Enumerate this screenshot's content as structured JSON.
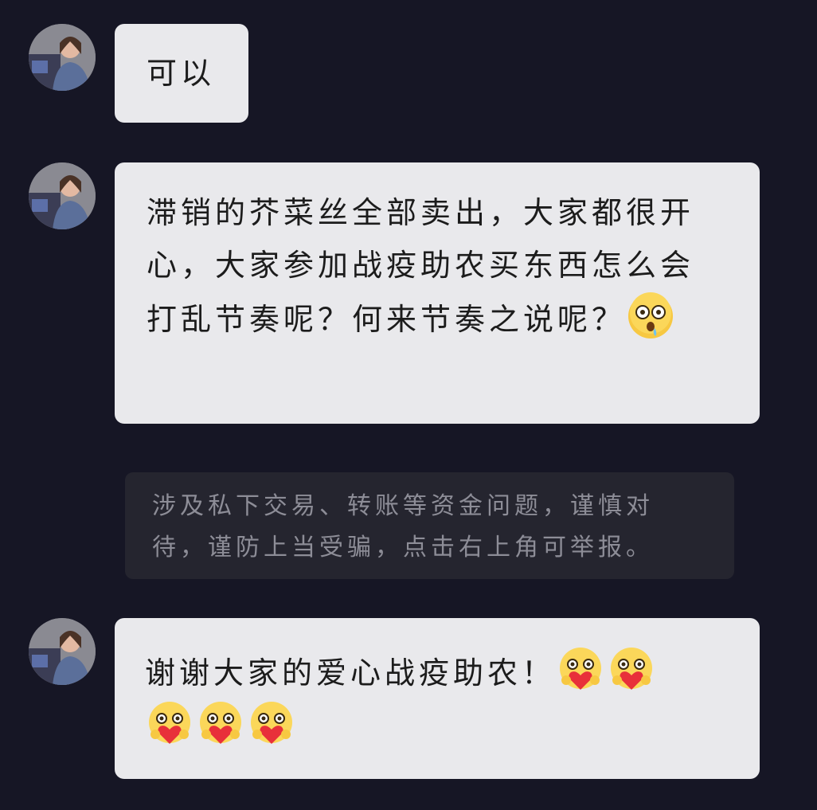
{
  "messages": [
    {
      "sender_avatar": "avatar-photo",
      "text": "可以",
      "emojis": []
    },
    {
      "sender_avatar": "avatar-photo",
      "text": "滞销的芥菜丝全部卖出，大家都很开心，大家参加战疫助农买东西怎么会打乱节奏呢？何来节奏之说呢？",
      "emojis": [
        "drooling-face-emoji"
      ]
    },
    {
      "sender_avatar": "avatar-photo",
      "text": "谢谢大家的爱心战疫助农！",
      "emojis": [
        "heart-hug-emoji",
        "heart-hug-emoji",
        "heart-hug-emoji",
        "heart-hug-emoji",
        "heart-hug-emoji"
      ]
    }
  ],
  "system_notice": {
    "text": "涉及私下交易、转账等资金问题，谨慎对待，谨防上当受骗，点击右上角可举报。"
  },
  "colors": {
    "background": "#161625",
    "bubble": "#e9e9ec",
    "notice_background": "#25252f",
    "notice_text": "#8d8d97"
  }
}
